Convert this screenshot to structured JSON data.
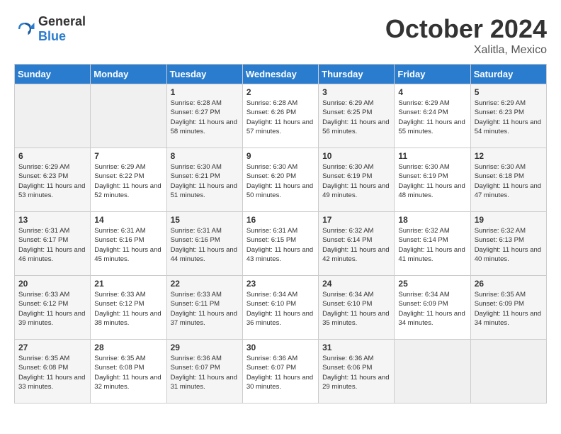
{
  "logo": {
    "text_general": "General",
    "text_blue": "Blue"
  },
  "title": "October 2024",
  "location": "Xalitla, Mexico",
  "weekdays": [
    "Sunday",
    "Monday",
    "Tuesday",
    "Wednesday",
    "Thursday",
    "Friday",
    "Saturday"
  ],
  "weeks": [
    [
      {
        "day": "",
        "info": ""
      },
      {
        "day": "",
        "info": ""
      },
      {
        "day": "1",
        "info": "Sunrise: 6:28 AM\nSunset: 6:27 PM\nDaylight: 11 hours and 58 minutes."
      },
      {
        "day": "2",
        "info": "Sunrise: 6:28 AM\nSunset: 6:26 PM\nDaylight: 11 hours and 57 minutes."
      },
      {
        "day": "3",
        "info": "Sunrise: 6:29 AM\nSunset: 6:25 PM\nDaylight: 11 hours and 56 minutes."
      },
      {
        "day": "4",
        "info": "Sunrise: 6:29 AM\nSunset: 6:24 PM\nDaylight: 11 hours and 55 minutes."
      },
      {
        "day": "5",
        "info": "Sunrise: 6:29 AM\nSunset: 6:23 PM\nDaylight: 11 hours and 54 minutes."
      }
    ],
    [
      {
        "day": "6",
        "info": "Sunrise: 6:29 AM\nSunset: 6:23 PM\nDaylight: 11 hours and 53 minutes."
      },
      {
        "day": "7",
        "info": "Sunrise: 6:29 AM\nSunset: 6:22 PM\nDaylight: 11 hours and 52 minutes."
      },
      {
        "day": "8",
        "info": "Sunrise: 6:30 AM\nSunset: 6:21 PM\nDaylight: 11 hours and 51 minutes."
      },
      {
        "day": "9",
        "info": "Sunrise: 6:30 AM\nSunset: 6:20 PM\nDaylight: 11 hours and 50 minutes."
      },
      {
        "day": "10",
        "info": "Sunrise: 6:30 AM\nSunset: 6:19 PM\nDaylight: 11 hours and 49 minutes."
      },
      {
        "day": "11",
        "info": "Sunrise: 6:30 AM\nSunset: 6:19 PM\nDaylight: 11 hours and 48 minutes."
      },
      {
        "day": "12",
        "info": "Sunrise: 6:30 AM\nSunset: 6:18 PM\nDaylight: 11 hours and 47 minutes."
      }
    ],
    [
      {
        "day": "13",
        "info": "Sunrise: 6:31 AM\nSunset: 6:17 PM\nDaylight: 11 hours and 46 minutes."
      },
      {
        "day": "14",
        "info": "Sunrise: 6:31 AM\nSunset: 6:16 PM\nDaylight: 11 hours and 45 minutes."
      },
      {
        "day": "15",
        "info": "Sunrise: 6:31 AM\nSunset: 6:16 PM\nDaylight: 11 hours and 44 minutes."
      },
      {
        "day": "16",
        "info": "Sunrise: 6:31 AM\nSunset: 6:15 PM\nDaylight: 11 hours and 43 minutes."
      },
      {
        "day": "17",
        "info": "Sunrise: 6:32 AM\nSunset: 6:14 PM\nDaylight: 11 hours and 42 minutes."
      },
      {
        "day": "18",
        "info": "Sunrise: 6:32 AM\nSunset: 6:14 PM\nDaylight: 11 hours and 41 minutes."
      },
      {
        "day": "19",
        "info": "Sunrise: 6:32 AM\nSunset: 6:13 PM\nDaylight: 11 hours and 40 minutes."
      }
    ],
    [
      {
        "day": "20",
        "info": "Sunrise: 6:33 AM\nSunset: 6:12 PM\nDaylight: 11 hours and 39 minutes."
      },
      {
        "day": "21",
        "info": "Sunrise: 6:33 AM\nSunset: 6:12 PM\nDaylight: 11 hours and 38 minutes."
      },
      {
        "day": "22",
        "info": "Sunrise: 6:33 AM\nSunset: 6:11 PM\nDaylight: 11 hours and 37 minutes."
      },
      {
        "day": "23",
        "info": "Sunrise: 6:34 AM\nSunset: 6:10 PM\nDaylight: 11 hours and 36 minutes."
      },
      {
        "day": "24",
        "info": "Sunrise: 6:34 AM\nSunset: 6:10 PM\nDaylight: 11 hours and 35 minutes."
      },
      {
        "day": "25",
        "info": "Sunrise: 6:34 AM\nSunset: 6:09 PM\nDaylight: 11 hours and 34 minutes."
      },
      {
        "day": "26",
        "info": "Sunrise: 6:35 AM\nSunset: 6:09 PM\nDaylight: 11 hours and 34 minutes."
      }
    ],
    [
      {
        "day": "27",
        "info": "Sunrise: 6:35 AM\nSunset: 6:08 PM\nDaylight: 11 hours and 33 minutes."
      },
      {
        "day": "28",
        "info": "Sunrise: 6:35 AM\nSunset: 6:08 PM\nDaylight: 11 hours and 32 minutes."
      },
      {
        "day": "29",
        "info": "Sunrise: 6:36 AM\nSunset: 6:07 PM\nDaylight: 11 hours and 31 minutes."
      },
      {
        "day": "30",
        "info": "Sunrise: 6:36 AM\nSunset: 6:07 PM\nDaylight: 11 hours and 30 minutes."
      },
      {
        "day": "31",
        "info": "Sunrise: 6:36 AM\nSunset: 6:06 PM\nDaylight: 11 hours and 29 minutes."
      },
      {
        "day": "",
        "info": ""
      },
      {
        "day": "",
        "info": ""
      }
    ]
  ]
}
